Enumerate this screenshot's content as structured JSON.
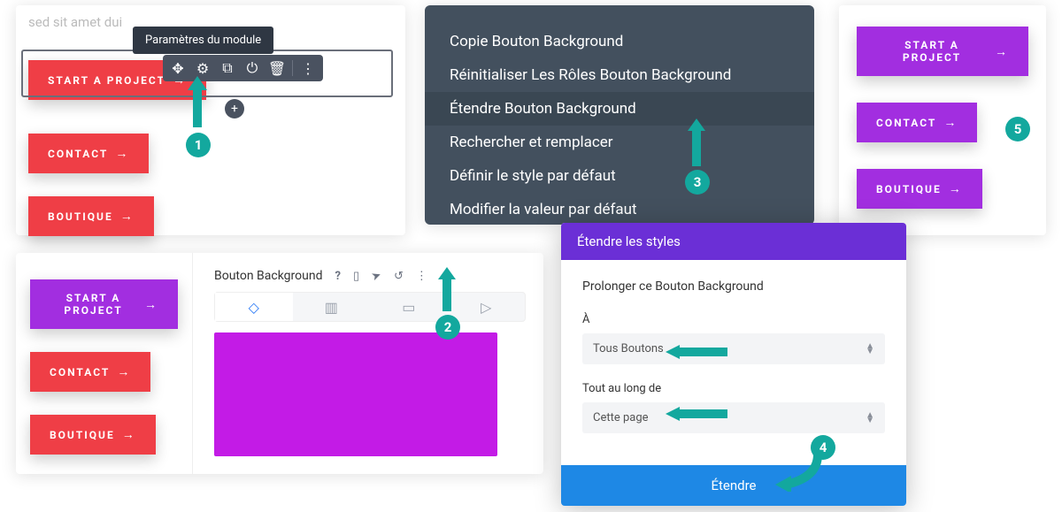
{
  "panel1": {
    "placeholder": "sed sit amet dui",
    "tooltip": "Paramètres du module",
    "buttons": {
      "b1": "START A PROJECT",
      "b2": "CONTACT",
      "b3": "BOUTIQUE"
    }
  },
  "context_menu": {
    "m1": "Copie Bouton Background",
    "m2": "Réinitialiser Les Rôles Bouton Background",
    "m3": "Étendre Bouton Background",
    "m4": "Rechercher et remplacer",
    "m5": "Définir le style par défaut",
    "m6": "Modifier la valeur par défaut"
  },
  "panel5": {
    "buttons": {
      "b1": "START A PROJECT",
      "b2": "CONTACT",
      "b3": "BOUTIQUE"
    }
  },
  "panel2": {
    "buttons": {
      "b1": "START A PROJECT",
      "b2": "CONTACT",
      "b3": "BOUTIQUE"
    },
    "section_title": "Bouton Background",
    "swatch_color": "#c31be6"
  },
  "modal": {
    "header": "Étendre les styles",
    "title": "Prolonger ce Bouton Background",
    "label_to": "À",
    "value_to": "Tous Boutons",
    "label_scope": "Tout au long de",
    "value_scope": "Cette page",
    "submit": "Étendre"
  },
  "steps": {
    "s1": "1",
    "s2": "2",
    "s3": "3",
    "s4": "4",
    "s5": "5"
  }
}
